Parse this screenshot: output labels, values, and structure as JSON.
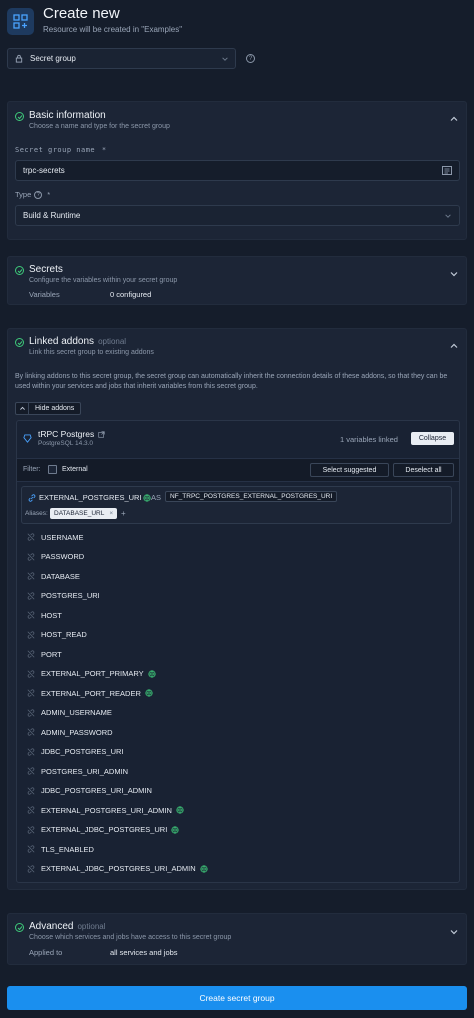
{
  "header": {
    "title": "Create new",
    "subtitle": "Resource will be created in \"Examples\""
  },
  "resource_type": {
    "value": "Secret group"
  },
  "basic": {
    "title": "Basic information",
    "desc": "Choose a name and type for the secret group",
    "name_label": "Secret group name",
    "required_mark": "*",
    "name_value": "trpc-secrets",
    "type_label": "Type",
    "type_required": "*",
    "type_value": "Build & Runtime"
  },
  "secrets": {
    "title": "Secrets",
    "desc": "Configure the variables within your secret group",
    "variables_label": "Variables",
    "variables_value": "0 configured"
  },
  "linked": {
    "title": "Linked addons",
    "optional": "optional",
    "desc": "Link this secret group to existing addons",
    "info": "By linking addons to this secret group, the secret group can automatically inherit the connection details of these addons, so that they can be used within your services and jobs that inherit variables from this secret group.",
    "hide_button": "Hide addons",
    "addon": {
      "name": "tRPC Postgres",
      "version": "PostgreSQL 14.3.0",
      "linked_count": "1 variables linked",
      "collapse_button": "Collapse",
      "filter_label": "Filter:",
      "external_label": "External",
      "select_suggested": "Select suggested",
      "deselect_all": "Deselect all",
      "linked_var": {
        "name": "EXTERNAL_POSTGRES_URI",
        "as": "AS",
        "alias_target": "NF_TRPC_POSTGRES_EXTERNAL_POSTGRES_URI",
        "aliases_label": "Aliases:",
        "alias_chip": "DATABASE_URL",
        "alias_remove": "×",
        "alias_add": "+"
      },
      "variables": [
        {
          "name": "USERNAME",
          "external": false
        },
        {
          "name": "PASSWORD",
          "external": false
        },
        {
          "name": "DATABASE",
          "external": false
        },
        {
          "name": "POSTGRES_URI",
          "external": false
        },
        {
          "name": "HOST",
          "external": false
        },
        {
          "name": "HOST_READ",
          "external": false
        },
        {
          "name": "PORT",
          "external": false
        },
        {
          "name": "EXTERNAL_PORT_PRIMARY",
          "external": true
        },
        {
          "name": "EXTERNAL_PORT_READER",
          "external": true
        },
        {
          "name": "ADMIN_USERNAME",
          "external": false
        },
        {
          "name": "ADMIN_PASSWORD",
          "external": false
        },
        {
          "name": "JDBC_POSTGRES_URI",
          "external": false
        },
        {
          "name": "POSTGRES_URI_ADMIN",
          "external": false
        },
        {
          "name": "JDBC_POSTGRES_URI_ADMIN",
          "external": false
        },
        {
          "name": "EXTERNAL_POSTGRES_URI_ADMIN",
          "external": true
        },
        {
          "name": "EXTERNAL_JDBC_POSTGRES_URI",
          "external": true
        },
        {
          "name": "TLS_ENABLED",
          "external": false
        },
        {
          "name": "EXTERNAL_JDBC_POSTGRES_URI_ADMIN",
          "external": true
        }
      ]
    }
  },
  "advanced": {
    "title": "Advanced",
    "optional": "optional",
    "desc": "Choose which services and jobs have access to this secret group",
    "applied_label": "Applied to",
    "applied_value": "all services and jobs"
  },
  "submit_label": "Create secret group",
  "colors": {
    "accent": "#1a8fef",
    "success": "#3ec97a",
    "background": "#151d2b",
    "panel": "#1c2536"
  }
}
